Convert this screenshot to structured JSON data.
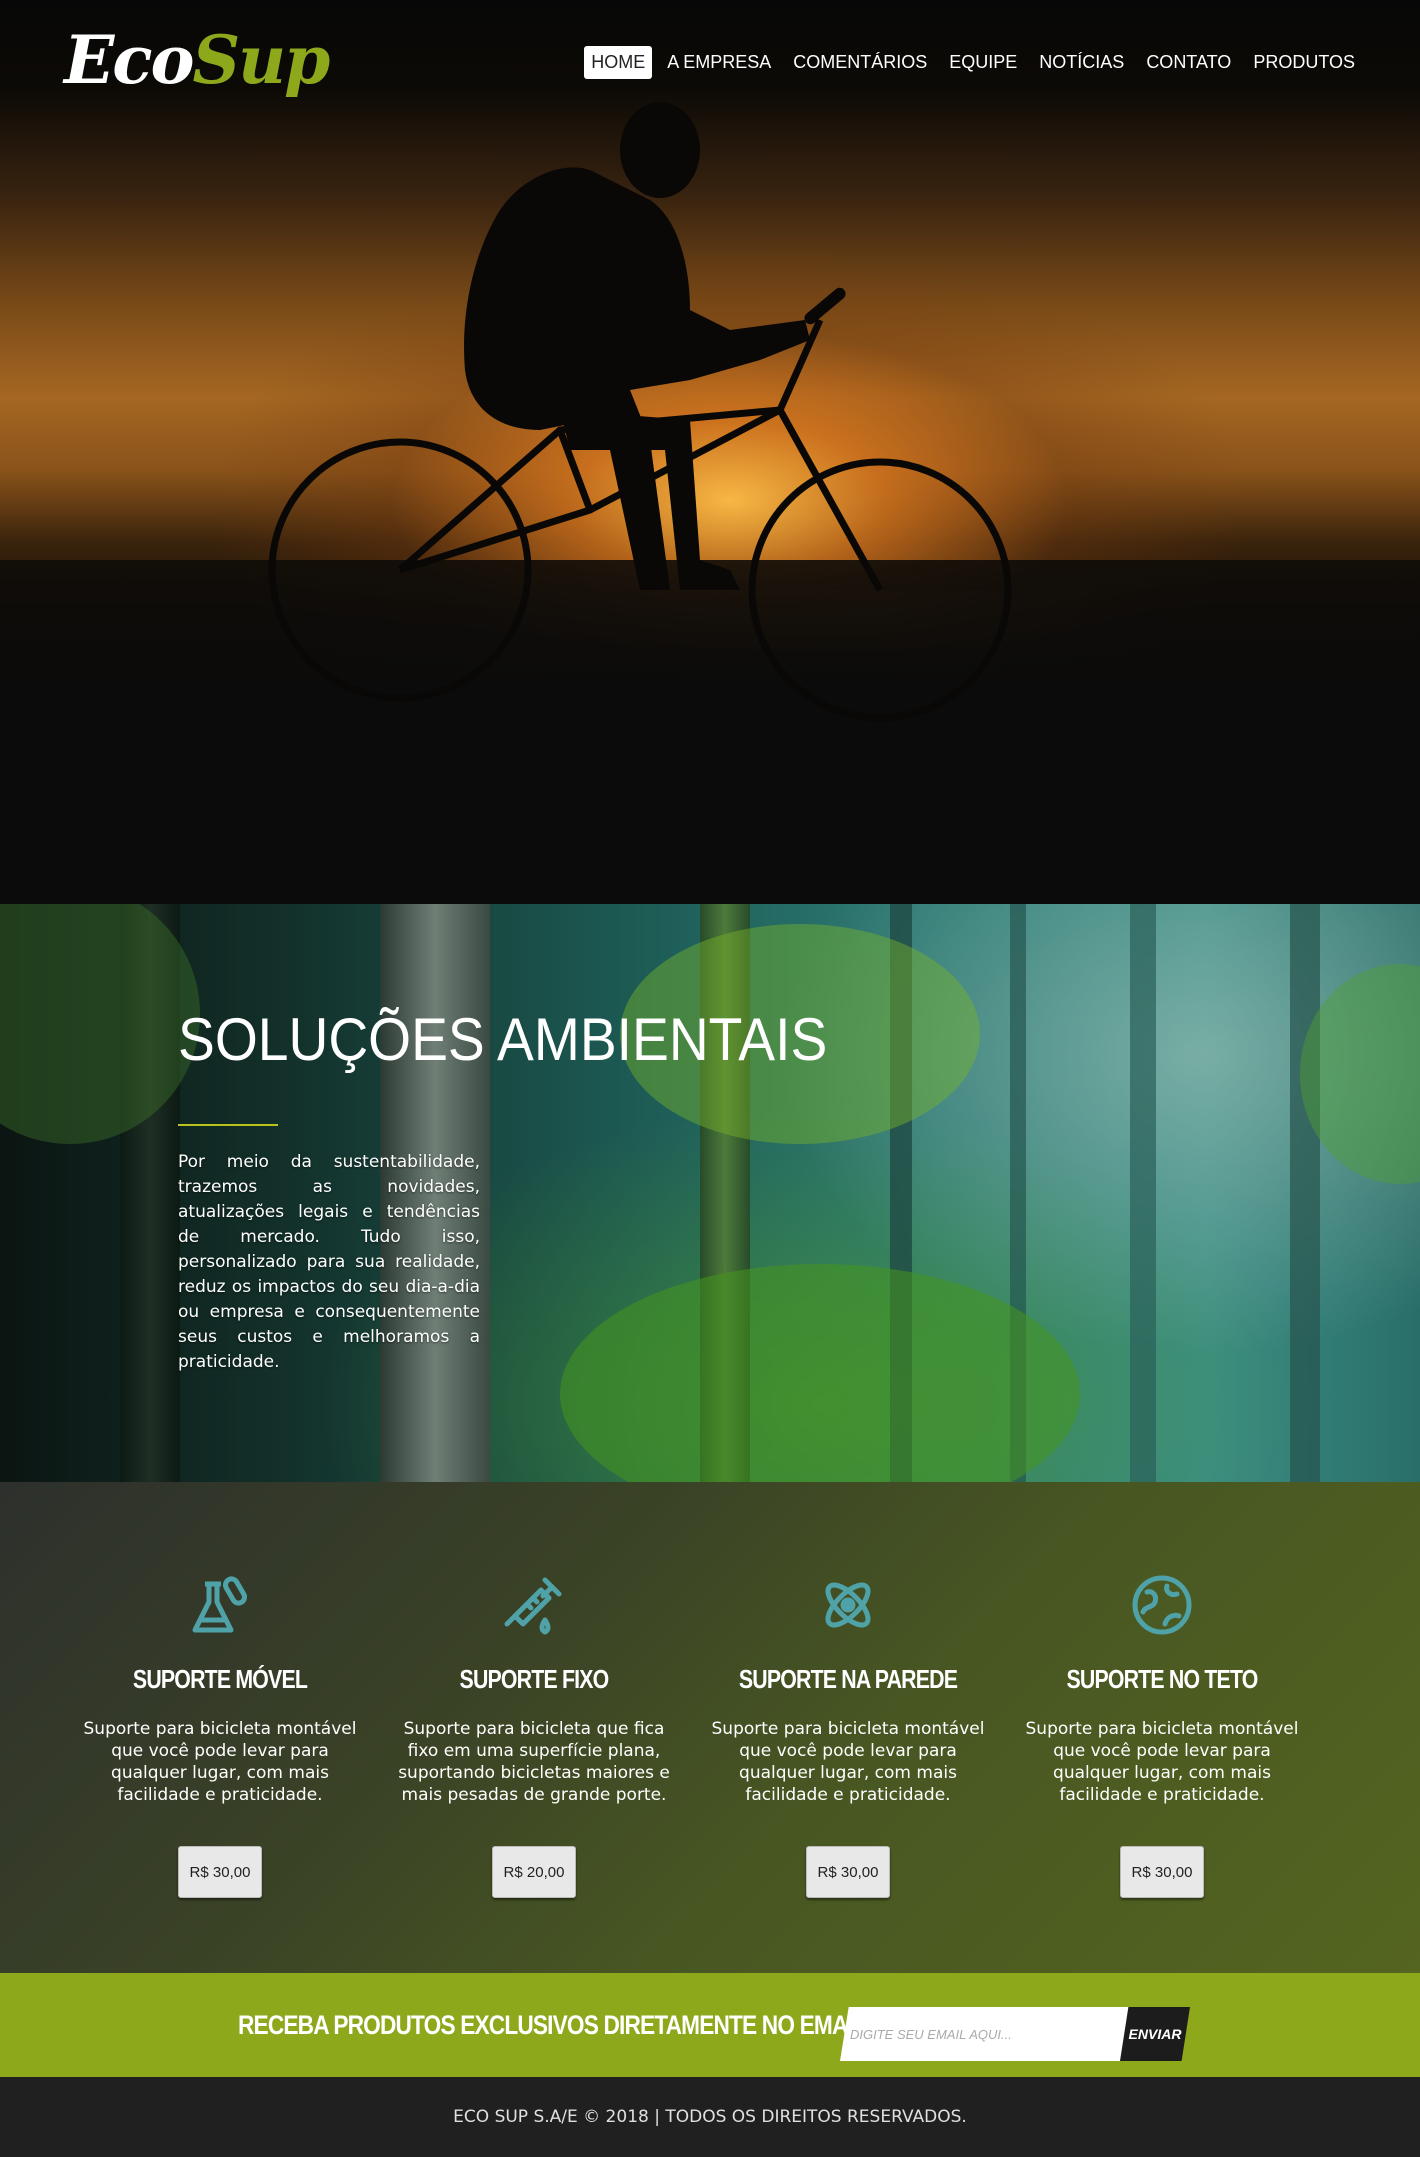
{
  "header": {
    "logo_part1": "Eco",
    "logo_part2": "Sup",
    "nav": [
      "HOME",
      "A EMPRESA",
      "COMENTÁRIOS",
      "EQUIPE",
      "NOTÍCIAS",
      "CONTATO",
      "PRODUTOS"
    ],
    "active_nav": "HOME"
  },
  "intro": {
    "title": "SOLUÇÕES AMBIENTAIS",
    "text": "Por meio da sustentabilidade, trazemos as novidades, atualizações legais e tendências de mercado. Tudo isso, personalizado para sua realidade, reduz os impactos do seu dia-a-dia ou empresa e consequentemente seus custos e melhoramos a praticidade."
  },
  "products": [
    {
      "icon": "flask-icon",
      "title": "SUPORTE MÓVEL",
      "description": "Suporte para bicicleta montável que você pode levar para qualquer lugar, com mais facilidade e praticidade.",
      "price": "R$ 30,00"
    },
    {
      "icon": "syringe-icon",
      "title": "SUPORTE FIXO",
      "description": "Suporte para bicicleta que fica fixo em uma superfície plana, suportando bicicletas maiores e mais pesadas de grande porte.",
      "price": "R$ 20,00"
    },
    {
      "icon": "atom-icon",
      "title": "SUPORTE NA PAREDE",
      "description": "Suporte para bicicleta montável que você pode levar para qualquer lugar, com mais facilidade e praticidade.",
      "price": "R$ 30,00"
    },
    {
      "icon": "globe-icon",
      "title": "SUPORTE NO TETO",
      "description": "Suporte para bicicleta montável que você pode levar para qualquer lugar, com mais facilidade e praticidade.",
      "price": "R$ 30,00"
    }
  ],
  "newsletter": {
    "text": "RECEBA PRODUTOS EXCLUSIVOS DIRETAMENTE NO EMAIL !",
    "placeholder": "DIGITE SEU EMAIL AQUI...",
    "button": "ENVIAR"
  },
  "footer": {
    "text": "ECO SUP S.A/E © 2018 | TODOS OS DIREITOS RESERVADOS."
  },
  "colors": {
    "accent_green": "#8ea81c",
    "icon_teal": "#4fa3a8",
    "footer_bg": "#202020"
  }
}
